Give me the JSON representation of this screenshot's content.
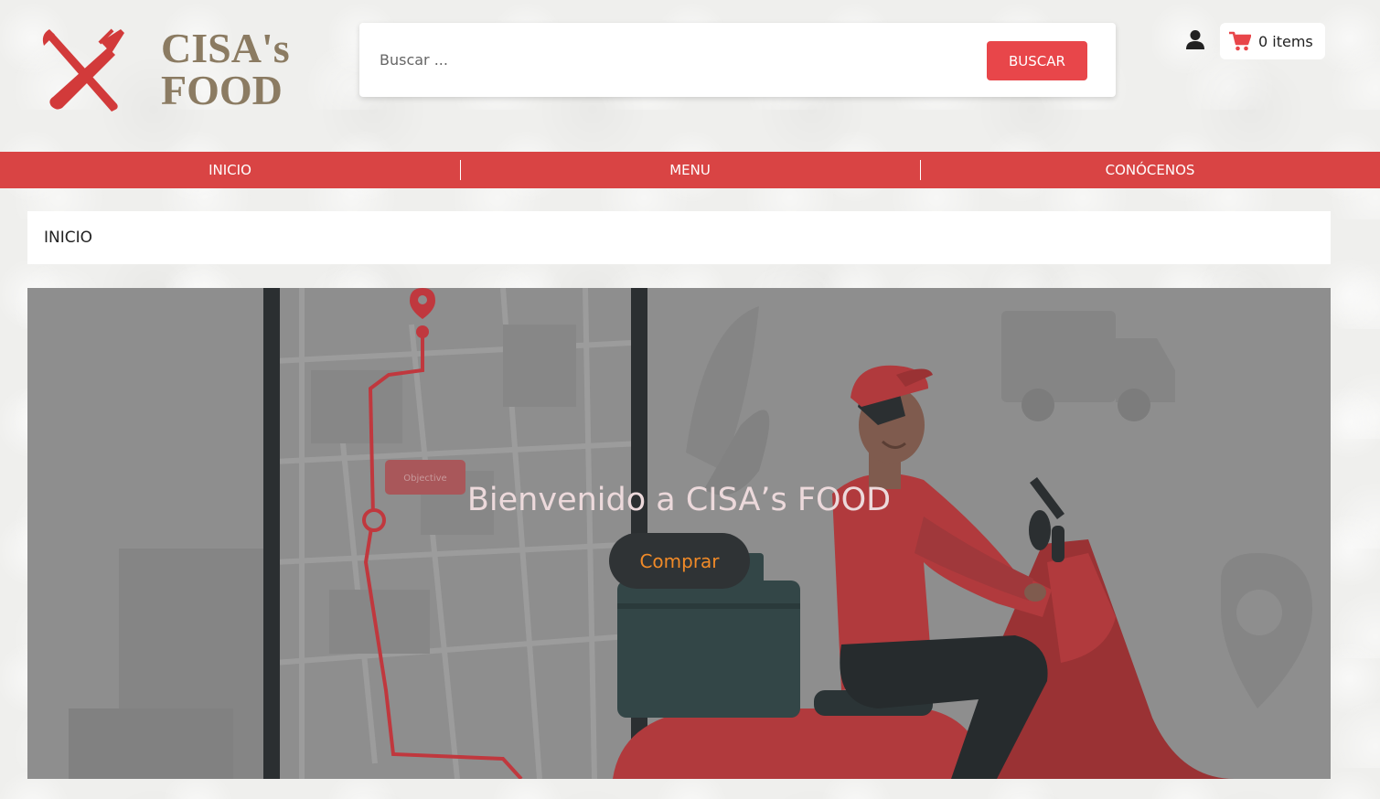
{
  "brand": {
    "logo_line1": "CISA's",
    "logo_line2": "FOOD",
    "logo_icon": "fork-knife-icon",
    "brand_color": "#d94444",
    "logo_text_color": "#8b7b62"
  },
  "search": {
    "placeholder": "Buscar ...",
    "value": "",
    "button_label": "BUSCAR",
    "button_color": "#e8464a"
  },
  "header": {
    "user_icon": "user-icon",
    "cart_icon": "shopping-cart-icon",
    "cart_label": "0 items"
  },
  "nav": {
    "items": [
      {
        "label": "INICIO"
      },
      {
        "label": "MENU"
      },
      {
        "label": "CONÓCENOS"
      }
    ]
  },
  "breadcrumb": {
    "current": "INICIO"
  },
  "hero": {
    "title": "Bienvenido a CISA’s FOOD",
    "button_label": "Comprar",
    "map_tag": "Objective",
    "button_text_color": "#f08a28",
    "overlay_color": "#8f8f8f"
  }
}
